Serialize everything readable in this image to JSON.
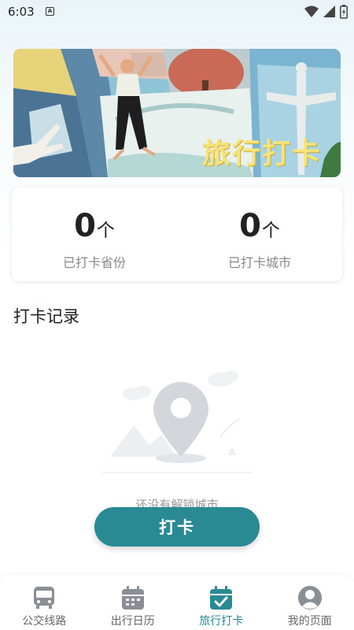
{
  "status": {
    "time": "6:03",
    "app_icon_letter": "A"
  },
  "banner": {
    "title": "旅行打卡"
  },
  "stats": [
    {
      "value": "0",
      "unit": "个",
      "label": "已打卡省份"
    },
    {
      "value": "0",
      "unit": "个",
      "label": "已打卡城市"
    }
  ],
  "section": {
    "title": "打卡记录"
  },
  "empty_state": {
    "text": "还没有解锁城市"
  },
  "checkin_button": {
    "label": "打卡"
  },
  "nav": {
    "items": [
      {
        "label": "公交线路",
        "icon": "bus-icon",
        "active": false
      },
      {
        "label": "出行日历",
        "icon": "calendar-icon",
        "active": false
      },
      {
        "label": "旅行打卡",
        "icon": "calendar-check-icon",
        "active": true
      },
      {
        "label": "我的页面",
        "icon": "user-icon",
        "active": false
      }
    ]
  },
  "colors": {
    "accent": "#2a8a93",
    "nav_inactive": "#777777",
    "banner_title": "#f6e37a"
  }
}
